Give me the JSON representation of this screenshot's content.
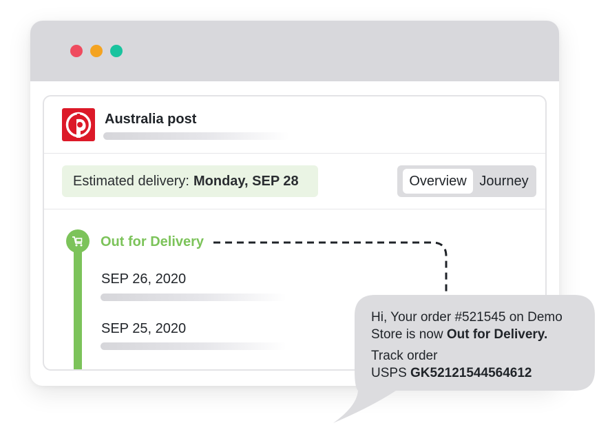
{
  "window": {
    "controls": [
      "close",
      "minimize",
      "maximize"
    ]
  },
  "carrier": {
    "name": "Australia post",
    "logo_icon": "australia-post-logo-icon"
  },
  "delivery": {
    "estimate_label": "Estimated delivery:",
    "estimate_date": "Monday, SEP 28"
  },
  "tabs": [
    {
      "label": "Overview",
      "active": true
    },
    {
      "label": "Journey",
      "active": false
    }
  ],
  "timeline": {
    "status_icon": "delivery-cart-icon",
    "status": "Out for Delivery",
    "events": [
      {
        "date": "SEP 26, 2020"
      },
      {
        "date": "SEP 25, 2020"
      }
    ]
  },
  "message": {
    "line1_prefix": "Hi, Your order #521545 on Demo Store is now",
    "line1_bold": "Out for Delivery.",
    "track_label": "Track order",
    "tracking_carrier": "USPS",
    "tracking_number": "GK52121544564612"
  },
  "colors": {
    "accent_green": "#7cc35a",
    "eta_background": "#eaf4e4",
    "brand_red": "#dc1928",
    "dot_red": "#ef4b5f",
    "dot_yellow": "#f4a321",
    "dot_green": "#19c39e",
    "bubble": "#dcdcdf"
  }
}
